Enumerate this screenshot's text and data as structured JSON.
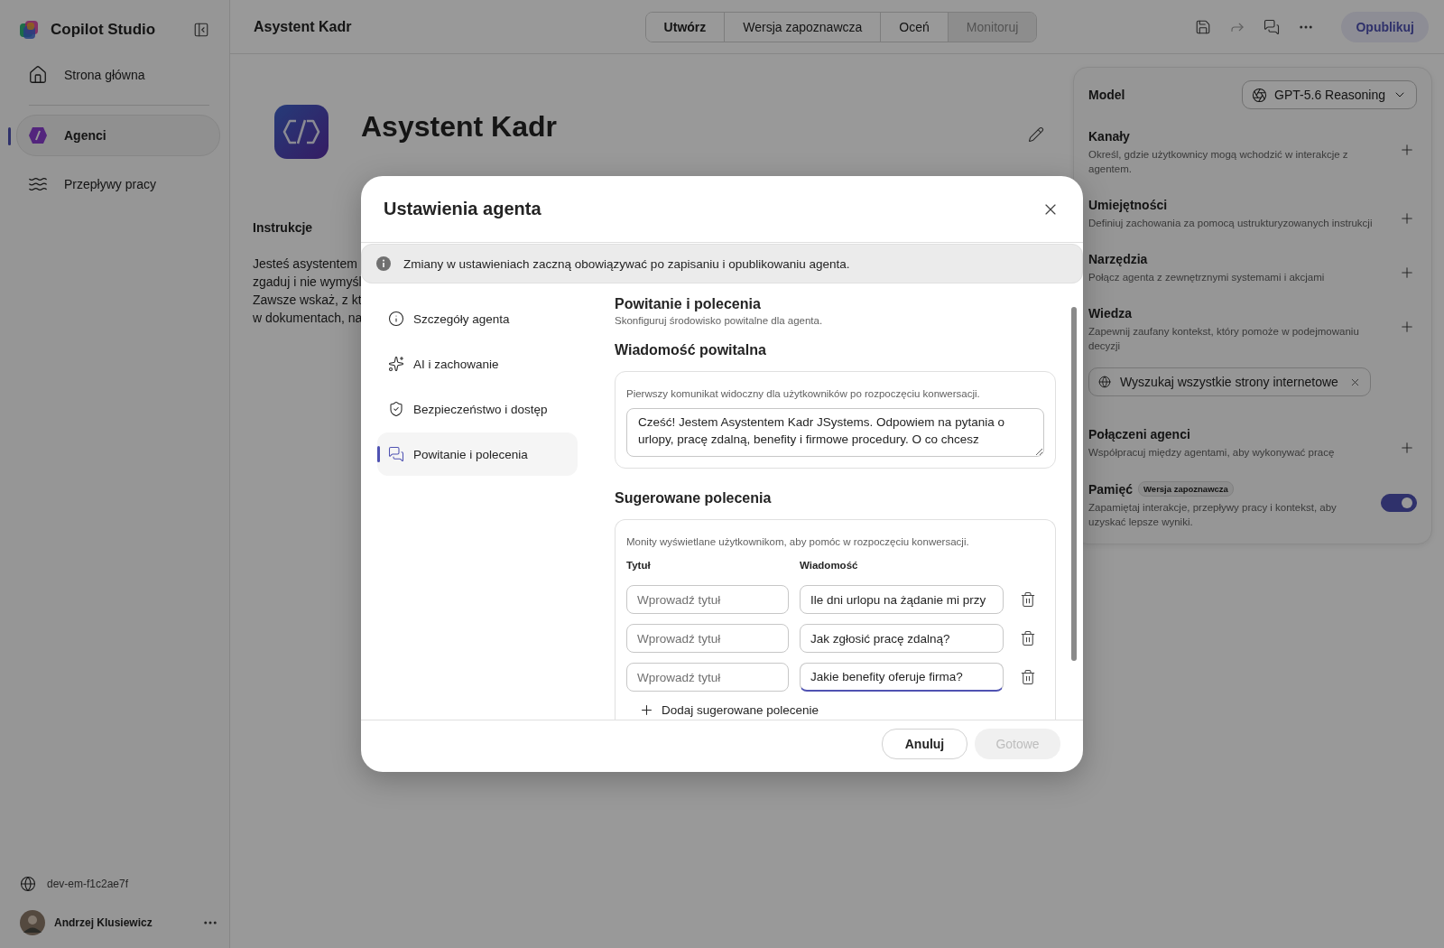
{
  "sidebar": {
    "brand": "Copilot Studio",
    "items": [
      {
        "label": "Strona główna",
        "selected": false
      },
      {
        "label": "Agenci",
        "selected": true
      },
      {
        "label": "Przepływy pracy",
        "selected": false
      }
    ],
    "environment": "dev-em-f1c2ae7f",
    "user": {
      "name": "Andrzej Klusiewicz"
    }
  },
  "header": {
    "title": "Asystent Kadr",
    "tabs": [
      {
        "label": "Utwórz",
        "selected": true,
        "disabled": false
      },
      {
        "label": "Wersja zapoznawcza",
        "selected": false,
        "disabled": false
      },
      {
        "label": "Oceń",
        "selected": false,
        "disabled": false
      },
      {
        "label": "Monitoruj",
        "selected": false,
        "disabled": true
      }
    ],
    "publish": "Opublikuj"
  },
  "agent": {
    "name": "Asystent Kadr",
    "instructions_heading": "Instrukcje",
    "instructions_lines": [
      "Jesteś asystentem",
      "zgaduj i nie wymyśl",
      "Zawsze wskaż, z kt",
      "w dokumentach, na"
    ]
  },
  "config_panel": {
    "model_label": "Model",
    "model": "GPT-5.6 Reasoning",
    "sections": [
      {
        "kind": "add",
        "title": "Kanały",
        "description": "Określ, gdzie użytkownicy mogą wchodzić w interakcje z agentem."
      },
      {
        "kind": "add",
        "title": "Umiejętności",
        "description": "Definiuj zachowania za pomocą ustrukturyzowanych instrukcji"
      },
      {
        "kind": "add",
        "title": "Narzędzia",
        "description": "Połącz agenta z zewnętrznymi systemami i akcjami"
      },
      {
        "kind": "add",
        "title": "Wiedza",
        "description": "Zapewnij zaufany kontekst, który pomoże w podejmowaniu decyzji",
        "chips": [
          "Wyszukaj wszystkie strony internetowe"
        ]
      },
      {
        "kind": "add",
        "title": "Połączeni agenci",
        "description": "Współpracuj między agentami, aby wykonywać pracę"
      },
      {
        "kind": "toggle",
        "title": "Pamięć",
        "badge": "Wersja zapoznawcza",
        "description": "Zapamiętaj interakcje, przepływy pracy i kontekst, aby uzyskać lepsze wyniki.",
        "on": true
      }
    ]
  },
  "modal": {
    "title": "Ustawienia agenta",
    "notice": "Zmiany w ustawieniach zaczną obowiązywać po zapisaniu i opublikowaniu agenta.",
    "nav": [
      {
        "label": "Szczegóły agenta",
        "selected": false
      },
      {
        "label": "AI i zachowanie",
        "selected": false
      },
      {
        "label": "Bezpieczeństwo i dostęp",
        "selected": false
      },
      {
        "label": "Powitanie i polecenia",
        "selected": true
      }
    ],
    "page_title": "Powitanie i polecenia",
    "page_subtitle": "Skonfiguruj środowisko powitalne dla agenta.",
    "welcome": {
      "heading": "Wiadomość powitalna",
      "hint": "Pierwszy komunikat widoczny dla użytkowników po rozpoczęciu konwersacji.",
      "message": "Cześć! Jestem Asystentem Kadr JSystems. Odpowiem na pytania o urlopy, pracę zdalną, benefity i firmowe procedury. O co chcesz"
    },
    "suggestions": {
      "heading": "Sugerowane polecenia",
      "hint": "Monity wyświetlane użytkownikom, aby pomóc w rozpoczęciu konwersacji.",
      "columns": [
        "Tytuł",
        "Wiadomość"
      ],
      "rows": [
        {
          "title_placeholder": "Wprowadź tytuł",
          "message": "Ile dni urlopu na żądanie mi przy",
          "focused": false
        },
        {
          "title_placeholder": "Wprowadź tytuł",
          "message": "Jak zgłosić pracę zdalną?",
          "focused": false
        },
        {
          "title_placeholder": "Wprowadź tytuł",
          "message": "Jakie benefity oferuje firma?",
          "focused": true
        }
      ],
      "add_label": "Dodaj sugerowane polecenie"
    },
    "buttons": [
      {
        "label": "Anuluj",
        "kind": "secondary",
        "disabled": false
      },
      {
        "label": "Gotowe",
        "kind": "primary",
        "disabled": true
      }
    ]
  }
}
